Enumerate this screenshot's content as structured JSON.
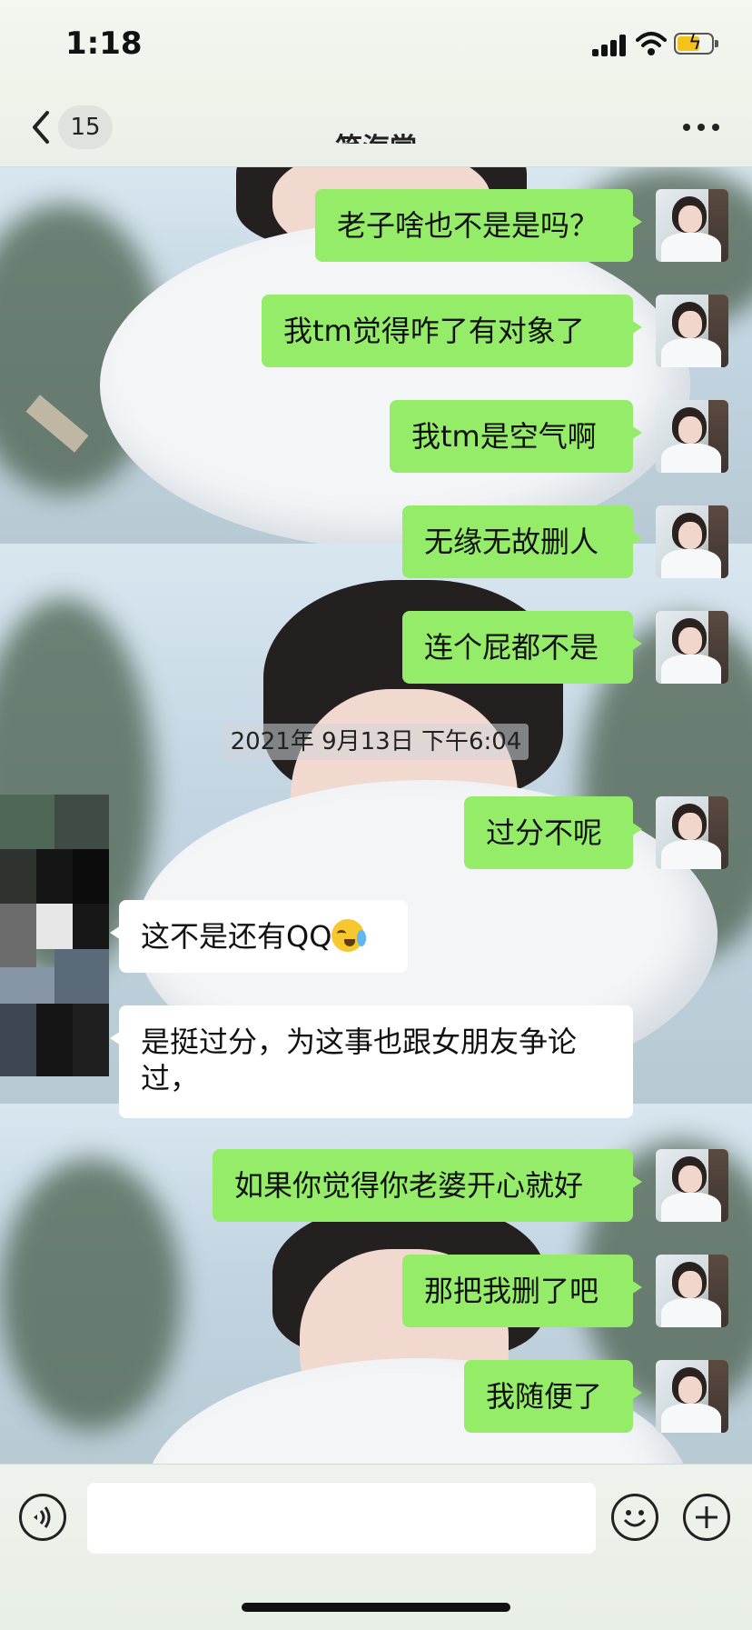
{
  "status_bar": {
    "time": "1:18"
  },
  "header": {
    "back_badge": "15",
    "title": "笑海棠"
  },
  "chat": {
    "timestamp": "2021年 9月13日 下午6:04",
    "messages": [
      {
        "from": "me",
        "text": "老子啥也不是是吗？"
      },
      {
        "from": "me",
        "text": "我tm觉得咋了有对象了"
      },
      {
        "from": "me",
        "text": "我tm是空气啊"
      },
      {
        "from": "me",
        "text": "无缘无故删人"
      },
      {
        "from": "me",
        "text": "连个屁都不是"
      },
      {
        "from": "me",
        "text": "过分不呢"
      },
      {
        "from": "them",
        "text": "这不是还有QQ"
      },
      {
        "from": "them",
        "text": "是挺过分，为这事也跟女朋友争论过，"
      },
      {
        "from": "me",
        "text": "如果你觉得你老婆开心就好"
      },
      {
        "from": "me",
        "text": "那把我删了吧"
      },
      {
        "from": "me",
        "text": "我随便了"
      }
    ]
  },
  "input": {
    "placeholder": ""
  },
  "icons": {
    "back": "chevron-left-icon",
    "more": "more-dots-icon",
    "voice": "voice-icon",
    "emoji": "emoji-icon",
    "plus": "plus-icon",
    "cry_emoji": "loudly-crying-face-emoji"
  },
  "colors": {
    "my_bubble": "#95ec69",
    "their_bubble": "#ffffff",
    "battery": "#f4c21b"
  }
}
